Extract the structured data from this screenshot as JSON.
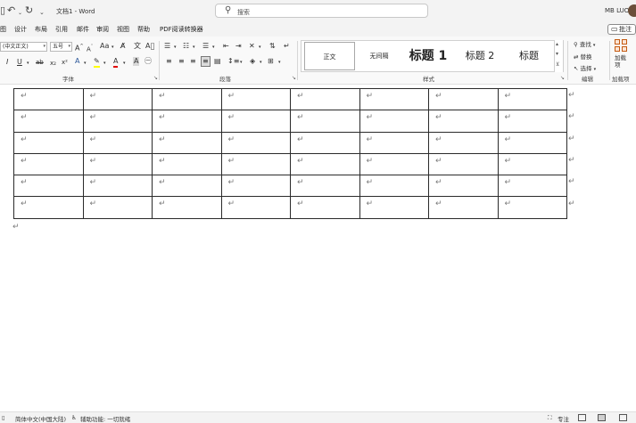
{
  "titlebar": {
    "doc_title": "文档1 - Word",
    "search_placeholder": "搜索",
    "user_name": "MB LUO",
    "icons": [
      "undo-icon",
      "redo-icon",
      "customize-quick-access-icon"
    ]
  },
  "menu": {
    "tabs": [
      "图",
      "设计",
      "布局",
      "引用",
      "邮件",
      "审阅",
      "视图",
      "帮助",
      "PDF阅读转换器"
    ],
    "comment_label": "批注"
  },
  "ribbon": {
    "font": {
      "family_value": "(中文正文)",
      "size_value": "五号",
      "label": "字体"
    },
    "paragraph": {
      "label": "段落"
    },
    "styles": {
      "label": "样式",
      "items": [
        "正文",
        "无间隔",
        "标题 1",
        "标题 2",
        "标题"
      ]
    },
    "editing": {
      "label": "编辑",
      "find": "查找",
      "replace": "替换",
      "select": "选择"
    },
    "addins": {
      "button": "加载项",
      "label": "加载项"
    }
  },
  "document": {
    "table": {
      "rows": 6,
      "cols": 8,
      "cell_mark": "↵"
    },
    "paragraph_mark": "↵"
  },
  "statusbar": {
    "language": "简体中文(中国大陆)",
    "accessibility": "辅助功能: 一切就绪",
    "focus": "专注"
  },
  "colors": {
    "accent_blue": "#2b579a",
    "highlight_yellow": "#ffff00",
    "font_red": "#e00000"
  }
}
